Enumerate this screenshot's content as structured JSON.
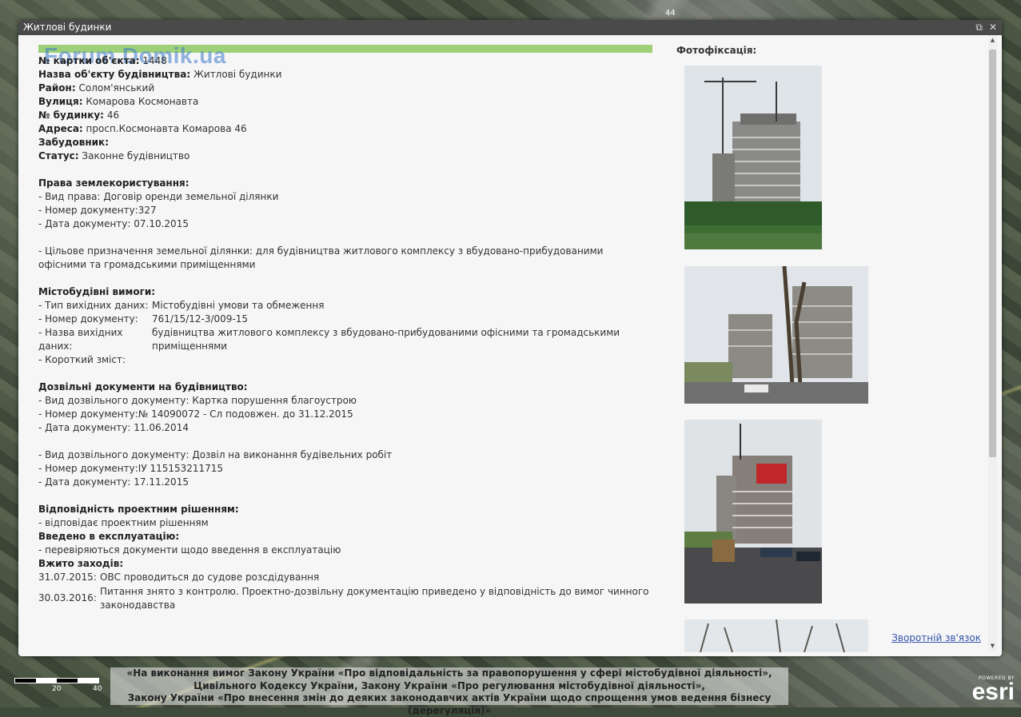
{
  "map": {
    "top_label": "44"
  },
  "popup": {
    "title": "Житлові будинки",
    "watermark": "Forum.Domik.ua",
    "fields": {
      "card_label": "№ картки об'єкта:",
      "card_value": "1448",
      "name_label": "Назва об'єкту будівництва:",
      "name_value": "Житлові будинки",
      "district_label": "Район:",
      "district_value": "Солом'янський",
      "street_label": "Вулиця:",
      "street_value": "Комарова Космонавта",
      "house_label": "№ будинку:",
      "house_value": "46",
      "address_label": "Адреса:",
      "address_value": "просп.Космонавта Комарова 46",
      "developer_label": "Забудовник:",
      "developer_value": "",
      "status_label": "Статус:",
      "status_value": "Законне будівництво"
    },
    "land": {
      "heading": "Права землекористування:",
      "right_type": "- Вид права: Договір оренди земельної ділянки",
      "doc_number": "- Номер документу:327",
      "doc_date": "- Дата документу:  07.10.2015",
      "purpose": "- Цільове призначення земельної ділянки: для будівництва житлового комплексу з вбудовано-прибудованими офісними та громадськими приміщеннями"
    },
    "urban": {
      "heading": "Містобудівні вимоги:",
      "type_k": "- Тип вихідних даних:",
      "type_v": "Містобудівні умови та обмеження",
      "num_k": "- Номер документу:",
      "num_v": "761/15/12-3/009-15",
      "name_k": "- Назва вихідних даних:",
      "name_v": "будівництва житлового комплексу з вбудовано-прибудованими офісними та громадськими приміщеннями",
      "summary_k": "- Короткий зміст:",
      "summary_v": ""
    },
    "permits": {
      "heading": "Дозвільні документи на будівництво:",
      "p1_type": "- Вид дозвільного документу: Картка порушення благоустрою",
      "p1_num": "- Номер документу:№ 14090072 - Сл подовжен. до 31.12.2015",
      "p1_date": "- Дата документу:  11.06.2014",
      "p2_type": "- Вид дозвільного документу: Дозвіл на виконання будівельних робіт",
      "p2_num": "- Номер документу:ІУ 115153211715",
      "p2_date": "- Дата документу:  17.11.2015"
    },
    "compliance": {
      "heading": "Відповідність проектним рішенням:",
      "value": "- відповідає проектним рішенням"
    },
    "commissioned": {
      "heading": "Введено в експлуатацію:",
      "value": "- перевіряються документи щодо введення в експлуатацію"
    },
    "measures": {
      "heading": "Вжито заходів:",
      "items": [
        {
          "date": "31.07.2015:",
          "text": "ОВС проводиться до судове розсдідування"
        },
        {
          "date": "30.03.2016:",
          "text": "Питання знято з контролю. Проектно-дозвільну документацію приведено у відповідність до вимог чинного законодавства"
        }
      ]
    },
    "photos_title": "Фотофіксація:",
    "feedback": "Зворотній зв'язок"
  },
  "footer": {
    "legal_1": "«На виконання вимог Закону України «Про відповідальність за правопорушення у сфері містобудівної діяльності»,",
    "legal_2": "Цивільного Кодексу України, Закону України «Про регулювання містобудівної діяльності»,",
    "legal_3": "Закону України «Про внесення змін до деяких законодавчих актів України щодо спрощення умов ведення бізнесу (дерегуляція)»",
    "scale_20": "20",
    "scale_40": "40",
    "powered_by": "POWERED BY",
    "esri": "esri"
  }
}
